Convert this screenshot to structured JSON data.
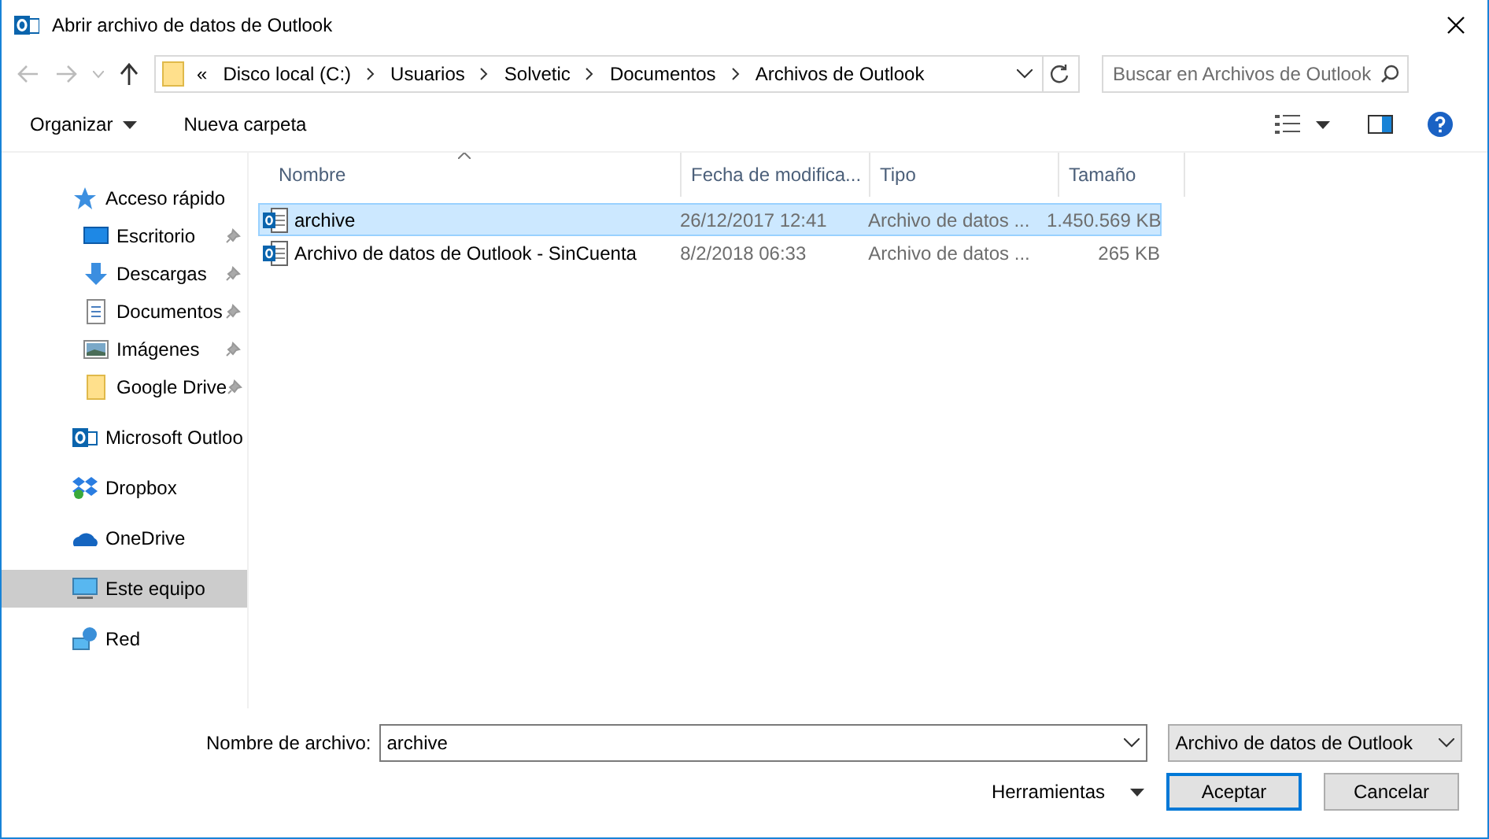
{
  "window": {
    "title": "Abrir archivo de datos de Outlook"
  },
  "address": {
    "prefix": "«",
    "crumbs": [
      "Disco local (C:)",
      "Usuarios",
      "Solvetic",
      "Documentos",
      "Archivos de Outlook"
    ]
  },
  "search": {
    "placeholder": "Buscar en Archivos de Outlook"
  },
  "toolbar": {
    "organize": "Organizar",
    "new_folder": "Nueva carpeta"
  },
  "sidebar": {
    "items": [
      {
        "label": "Acceso rápido",
        "selected": false,
        "children": [
          {
            "label": "Escritorio",
            "pinned": true,
            "selected": false
          },
          {
            "label": "Descargas",
            "pinned": true,
            "selected": false
          },
          {
            "label": "Documentos",
            "pinned": true,
            "selected": false
          },
          {
            "label": "Imágenes",
            "pinned": true,
            "selected": false
          },
          {
            "label": "Google Drive",
            "pinned": true,
            "selected": false
          }
        ]
      },
      {
        "label": "Microsoft Outloo",
        "selected": false
      },
      {
        "label": "Dropbox",
        "selected": false
      },
      {
        "label": "OneDrive",
        "selected": false
      },
      {
        "label": "Este equipo",
        "selected": true
      },
      {
        "label": "Red",
        "selected": false
      }
    ]
  },
  "table": {
    "columns": [
      {
        "label": "Nombre",
        "sorted": true
      },
      {
        "label": "Fecha de modifica...",
        "sorted": false
      },
      {
        "label": "Tipo",
        "sorted": false
      },
      {
        "label": "Tamaño",
        "sorted": false
      }
    ],
    "rows": [
      {
        "name": "archive",
        "date": "26/12/2017 12:41",
        "type": "Archivo de datos ...",
        "size": "1.450.569 KB",
        "selected": true
      },
      {
        "name": "Archivo de datos de Outlook - SinCuenta",
        "date": "8/2/2018 06:33",
        "type": "Archivo de datos ...",
        "size": "265 KB",
        "selected": false
      }
    ]
  },
  "file_name": {
    "label": "Nombre de archivo:",
    "value": "archive"
  },
  "file_type": {
    "value": "Archivo de datos de Outlook"
  },
  "tools": "Herramientas",
  "buttons": [
    {
      "label": "Aceptar",
      "default": true
    },
    {
      "label": "Cancelar",
      "default": false
    }
  ]
}
